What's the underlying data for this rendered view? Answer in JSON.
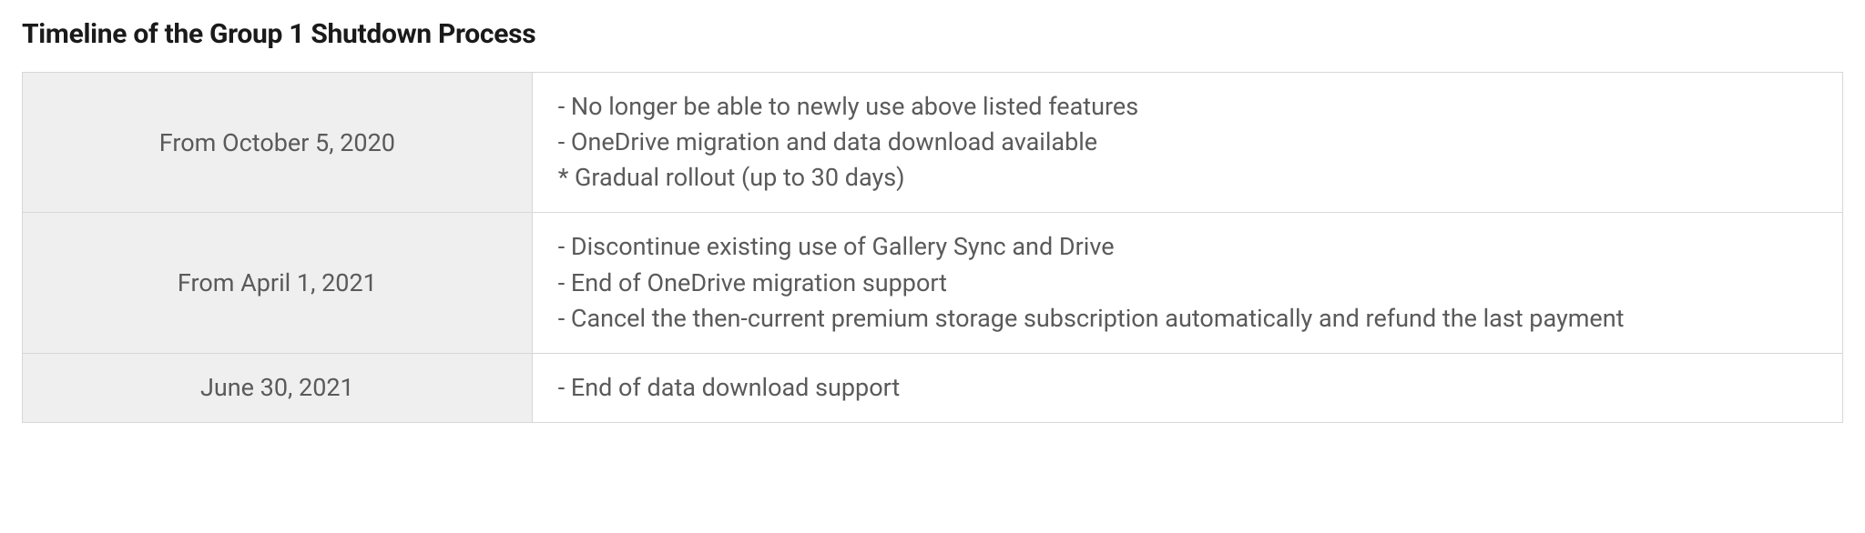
{
  "title": "Timeline of the Group 1 Shutdown Process",
  "rows": [
    {
      "date": "From October 5, 2020",
      "desc": "- No longer be able to newly use above listed features\n- OneDrive migration and data download available\n* Gradual rollout (up to 30 days)"
    },
    {
      "date": "From April 1, 2021",
      "desc": "- Discontinue existing use of Gallery Sync and Drive\n- End of OneDrive migration support\n- Cancel the then-current premium storage subscription automatically and refund the last payment"
    },
    {
      "date": "June 30, 2021",
      "desc": "- End of data download support"
    }
  ]
}
